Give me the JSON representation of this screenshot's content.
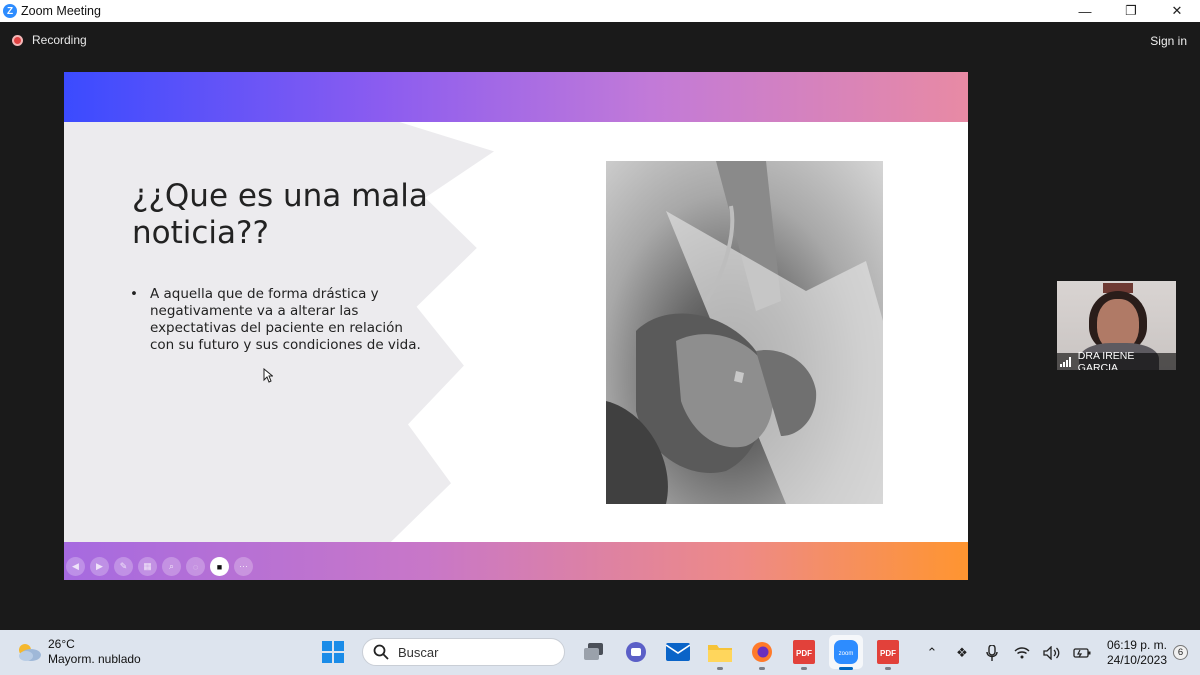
{
  "window": {
    "title": "Zoom Meeting",
    "minimize": "—",
    "restore": "❐",
    "close": "✕"
  },
  "meeting": {
    "recording_label": "Recording",
    "sign_in": "Sign in"
  },
  "slide": {
    "title": "¿¿Que es una mala noticia??",
    "bullet": "A aquella que de forma drástica y negativamente va a alterar  las expectativas del paciente en relación con su futuro y sus condiciones de vida.",
    "bullet_marker": "•"
  },
  "participant": {
    "name": "DRA IRENE GARCIA"
  },
  "taskbar": {
    "weather": {
      "temp": "26°C",
      "desc": "Mayorm. nublado"
    },
    "search_placeholder": "Buscar",
    "clock": {
      "time": "06:19 p. m.",
      "date": "24/10/2023"
    },
    "notifications": "6"
  },
  "colors": {
    "accent": "#2d8cff",
    "record": "#e04343",
    "taskbar": "#dde4ee"
  }
}
